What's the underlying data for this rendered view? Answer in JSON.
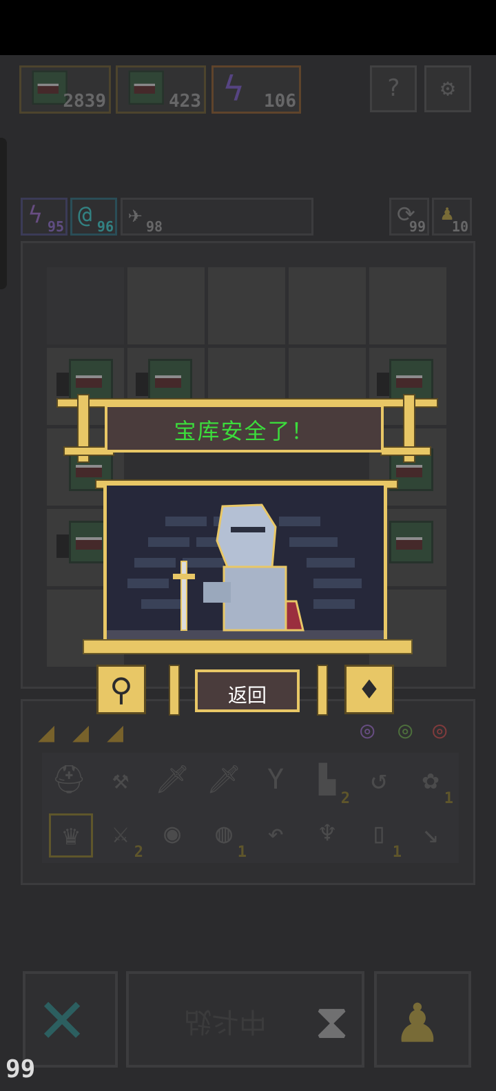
{
  "resources": [
    {
      "icon": "green-monster-icon",
      "value": "2839"
    },
    {
      "icon": "green-monster-icon",
      "value": "423"
    },
    {
      "icon": "lightning-icon",
      "value": "106"
    }
  ],
  "top_buttons": [
    {
      "icon": "question-icon",
      "glyph": "?"
    },
    {
      "icon": "gear-icon",
      "glyph": "⚙"
    }
  ],
  "counters_left": [
    {
      "icon": "lightning-icon",
      "value": "95"
    },
    {
      "icon": "spiral-icon",
      "value": "96"
    },
    {
      "icon": "bird-icon",
      "value": "98"
    }
  ],
  "counters_right": [
    {
      "icon": "refresh-arrows-icon",
      "value": "99"
    },
    {
      "icon": "pawn-icon",
      "value": "10"
    }
  ],
  "popup": {
    "title": "宝库安全了！",
    "return_label": "返回"
  },
  "inventory": {
    "row1": [
      {
        "icon": "helmet-icon",
        "glyph": "⛑",
        "count": ""
      },
      {
        "icon": "hammer-icon",
        "glyph": "⚒",
        "count": ""
      },
      {
        "icon": "sword-icon",
        "glyph": "🗡",
        "count": ""
      },
      {
        "icon": "sword-icon",
        "glyph": "🗡",
        "count": ""
      },
      {
        "icon": "slingshot-icon",
        "glyph": "Y",
        "count": ""
      },
      {
        "icon": "pipe-icon",
        "glyph": "▙",
        "count": "2"
      },
      {
        "icon": "scythe-icon",
        "glyph": "↺",
        "count": ""
      },
      {
        "icon": "vine-icon",
        "glyph": "✿",
        "count": "1"
      }
    ],
    "row2": [
      {
        "icon": "claw-icon",
        "glyph": "♛",
        "count": ""
      },
      {
        "icon": "axe-icon",
        "glyph": "⚔",
        "count": "2"
      },
      {
        "icon": "shield-icon",
        "glyph": "◉",
        "count": ""
      },
      {
        "icon": "orb-icon",
        "glyph": "◍",
        "count": "1"
      },
      {
        "icon": "boomerang-icon",
        "glyph": "↶",
        "count": ""
      },
      {
        "icon": "mask-icon",
        "glyph": "♆",
        "count": ""
      },
      {
        "icon": "jar-icon",
        "glyph": "▯",
        "count": "1"
      },
      {
        "icon": "spear-icon",
        "glyph": "↘",
        "count": ""
      }
    ]
  },
  "battle_label": "战斗中",
  "corner_value": "99"
}
